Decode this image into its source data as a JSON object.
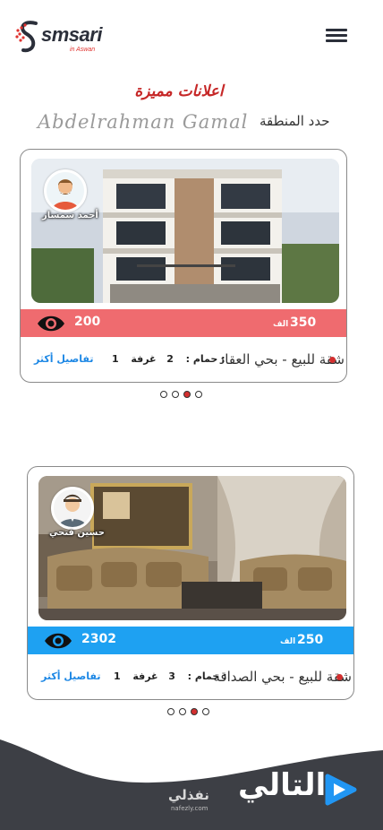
{
  "header": {
    "logo_text": "smsari",
    "logo_sub": "in Aswan",
    "menu_icon": "hamburger-menu-icon"
  },
  "featured_title": "اعلانات مميزة",
  "signature": "Abdelrahman Gamal",
  "region_label": "حدد المنطقة",
  "listings": [
    {
      "agent_name": "أحمد سمسار",
      "views": "200",
      "price": "350",
      "price_unit": "الف",
      "title": "شقة للبيع - بحي العقاد",
      "rooms_label": "غرفة :",
      "rooms": "2",
      "baths_label": "حمام :",
      "baths": "1",
      "details_label": "تفاصيل أكثر",
      "band_color": "#ef6b6f",
      "dots": 4,
      "active_dot": 2
    },
    {
      "agent_name": "حسين فتحي",
      "views": "2302",
      "price": "250",
      "price_unit": "الف",
      "title": "شقة للبيع - بحي الصداقة",
      "rooms_label": "غرفة :",
      "rooms": "3",
      "baths_label": "حمام :",
      "baths": "1",
      "details_label": "تفاصيل أكثر",
      "band_color": "#1ea1f2",
      "dots": 4,
      "active_dot": 2
    }
  ],
  "footer": {
    "brand": "نفذلي",
    "brand_sub": "nafezly.com",
    "next_label": "التالي",
    "next_icon": "play-icon",
    "accent": "#2196f3",
    "background": "#3d3f45"
  }
}
